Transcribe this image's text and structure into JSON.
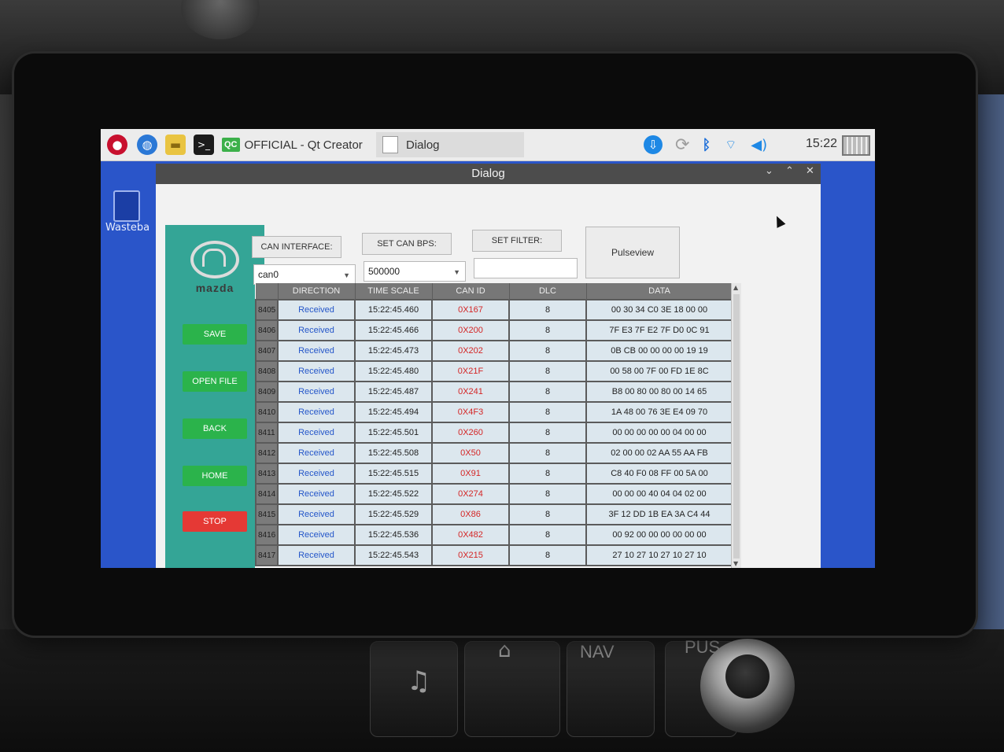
{
  "taskbar": {
    "tasks": [
      {
        "label": "OFFICIAL - Qt Creator",
        "icon": "qt-creator-icon"
      },
      {
        "label": "Dialog",
        "icon": "window-icon"
      }
    ],
    "launchers": [
      "raspberry-menu-icon",
      "web-browser-icon",
      "file-manager-icon",
      "terminal-icon"
    ],
    "tray_icons": [
      "download-icon",
      "sync-icon",
      "bluetooth-icon",
      "wifi-icon",
      "volume-icon"
    ],
    "clock": "15:22",
    "qt_badge": "QC"
  },
  "desktop": {
    "wastebasket_label": "Wasteba"
  },
  "dialog": {
    "title": "Dialog",
    "controls": {
      "minimize": "⌄",
      "maximize": "⌃",
      "close": "✕"
    }
  },
  "sidebar": {
    "brand": "mazda",
    "buttons": {
      "save": "SAVE",
      "open_file": "OPEN FILE",
      "back": "BACK",
      "home": "HOME",
      "stop": "STOP"
    }
  },
  "toolbar": {
    "can_interface_label": "CAN INTERFACE:",
    "set_can_bps_label": "SET CAN BPS:",
    "set_filter_label": "SET FILTER:",
    "pulseview_label": "Pulseview",
    "can_interface_value": "can0",
    "can_bps_value": "500000",
    "filter_value": ""
  },
  "table": {
    "columns": [
      "DIRECTION",
      "TIME SCALE",
      "CAN ID",
      "DLC",
      "DATA"
    ],
    "rows": [
      {
        "n": "8405",
        "dir": "Received",
        "time": "15:22:45.460",
        "id": "0X167",
        "dlc": "8",
        "data": "00 30 34 C0 3E 18 00 00"
      },
      {
        "n": "8406",
        "dir": "Received",
        "time": "15:22:45.466",
        "id": "0X200",
        "dlc": "8",
        "data": "7F E3 7F E2 7F D0 0C 91"
      },
      {
        "n": "8407",
        "dir": "Received",
        "time": "15:22:45.473",
        "id": "0X202",
        "dlc": "8",
        "data": "0B CB 00 00 00 00 19 19"
      },
      {
        "n": "8408",
        "dir": "Received",
        "time": "15:22:45.480",
        "id": "0X21F",
        "dlc": "8",
        "data": "00 58 00 7F 00 FD 1E 8C"
      },
      {
        "n": "8409",
        "dir": "Received",
        "time": "15:22:45.487",
        "id": "0X241",
        "dlc": "8",
        "data": "B8 00 80 00 80 00 14 65"
      },
      {
        "n": "8410",
        "dir": "Received",
        "time": "15:22:45.494",
        "id": "0X4F3",
        "dlc": "8",
        "data": "1A 48 00 76 3E E4 09 70"
      },
      {
        "n": "8411",
        "dir": "Received",
        "time": "15:22:45.501",
        "id": "0X260",
        "dlc": "8",
        "data": "00 00 00 00 00 04 00 00"
      },
      {
        "n": "8412",
        "dir": "Received",
        "time": "15:22:45.508",
        "id": "0X50",
        "dlc": "8",
        "data": "02 00 00 02 AA 55 AA FB"
      },
      {
        "n": "8413",
        "dir": "Received",
        "time": "15:22:45.515",
        "id": "0X91",
        "dlc": "8",
        "data": "C8 40 F0 08 FF 00 5A 00"
      },
      {
        "n": "8414",
        "dir": "Received",
        "time": "15:22:45.522",
        "id": "0X274",
        "dlc": "8",
        "data": "00 00 00 40 04 04 02 00"
      },
      {
        "n": "8415",
        "dir": "Received",
        "time": "15:22:45.529",
        "id": "0X86",
        "dlc": "8",
        "data": "3F 12 DD 1B EA 3A C4 44"
      },
      {
        "n": "8416",
        "dir": "Received",
        "time": "15:22:45.536",
        "id": "0X482",
        "dlc": "8",
        "data": "00 92 00 00 00 00 00 00"
      },
      {
        "n": "8417",
        "dir": "Received",
        "time": "15:22:45.543",
        "id": "0X215",
        "dlc": "8",
        "data": "27 10 27 10 27 10 27 10"
      }
    ]
  },
  "car_console": {
    "labels": [
      "NAV",
      "PUS"
    ]
  },
  "colors": {
    "sidebar_bg": "#34a596",
    "button_green": "#2bb34b",
    "button_red": "#e53935",
    "desktop_bg": "#2a55c9",
    "direction_text": "#2456c9",
    "can_id_text": "#d42525"
  }
}
